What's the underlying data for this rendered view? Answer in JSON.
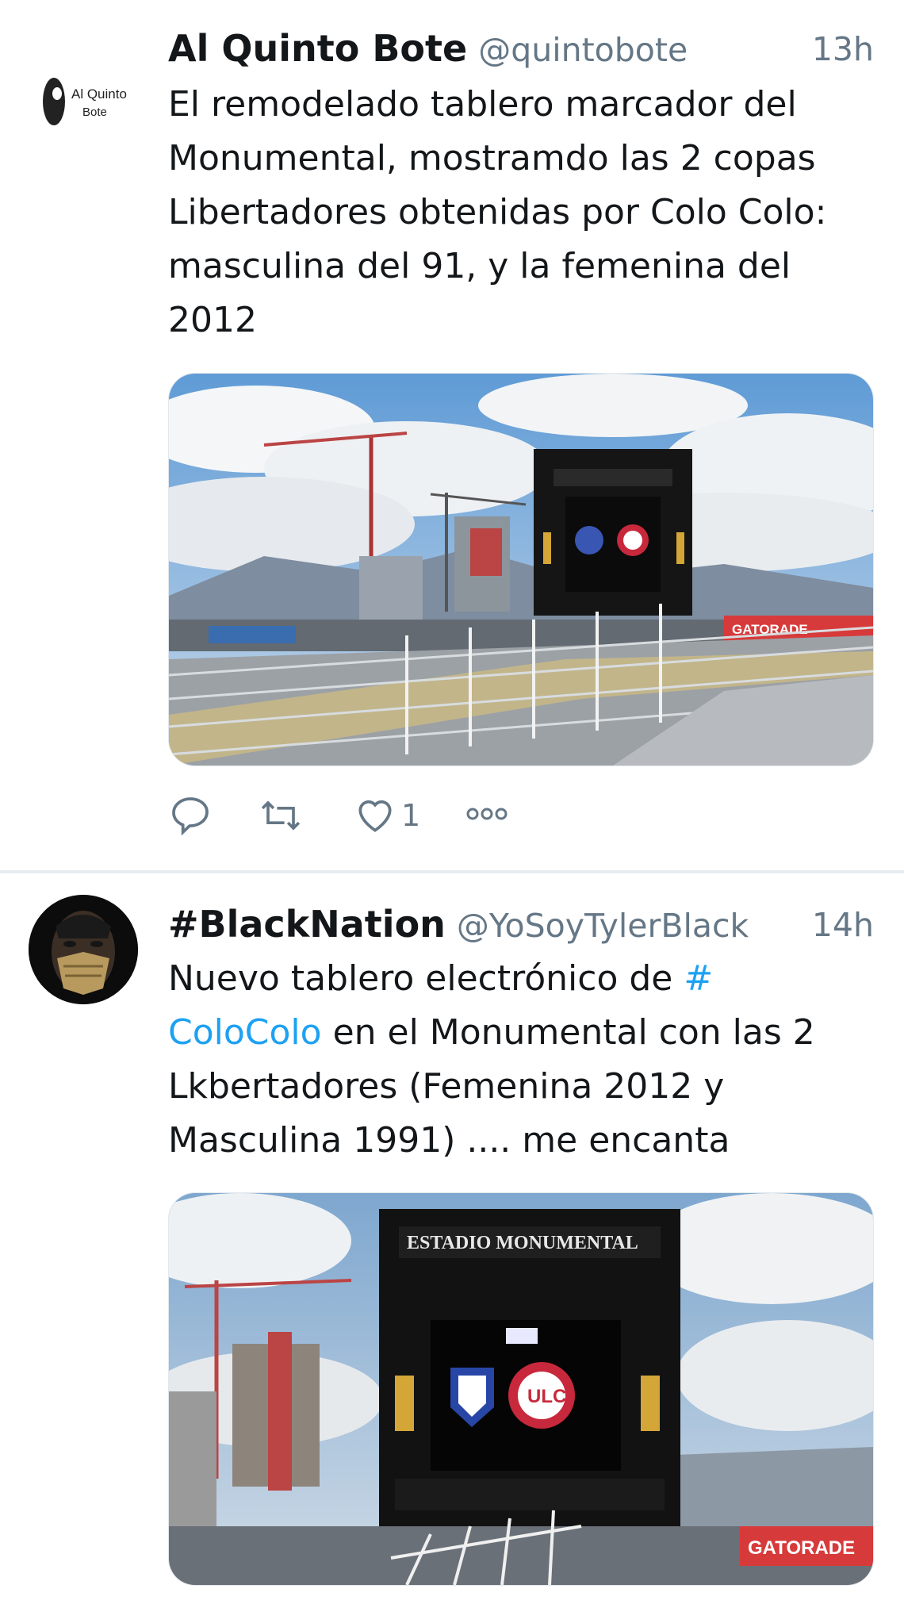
{
  "tweets": [
    {
      "avatar": "al-quinto-bote-logo",
      "avatar_text": [
        "Al Quinto",
        "Bote"
      ],
      "name": "Al Quinto Bote",
      "handle": "@quintobote",
      "time": "13h",
      "text_lines": [
        "El remodelado tablero marcador del",
        "Monumental, mostramdo las 2 copas",
        "Libertadores obtenidas por Colo Colo:",
        "masculina del 91, y la femenina del",
        "2012"
      ],
      "media": "stadium-scoreboard-photo",
      "actions": {
        "reply_icon": "reply-icon",
        "retweet_icon": "retweet-icon",
        "like_icon": "heart-icon",
        "like_count": "1",
        "more_icon": "more-icon"
      }
    },
    {
      "avatar": "masked-face-avatar",
      "name": "#BlackNation",
      "handle": "@YoSoyTylerBlack",
      "time": "14h",
      "text_parts": {
        "line1_prefix": "Nuevo tablero electrónico de ",
        "line1_link": "#",
        "line2_link": "ColoColo",
        "line2_suffix": " en el Monumental con las 2",
        "line3": "Lkbertadores (Femenina 2012 y",
        "line4": "Masculina 1991) .... me encanta"
      },
      "media": "scoreboard-closeup-photo"
    }
  ],
  "scoreboard": {
    "header": "ESTADIO MONUMENTAL",
    "right_crest": "ULC",
    "sponsor": "GATORADE"
  },
  "colors": {
    "link": "#1da1f2",
    "secondary_text": "#657786",
    "divider": "#e6ecf0"
  }
}
